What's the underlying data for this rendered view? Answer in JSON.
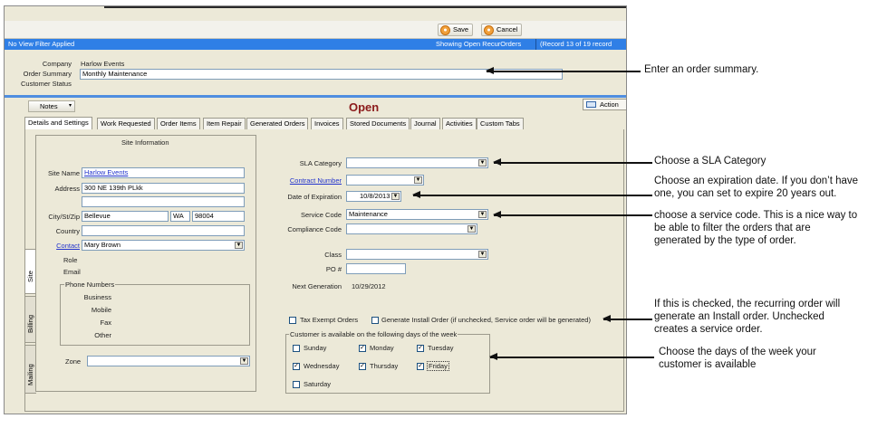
{
  "toolbar": {
    "save_label": "Save",
    "cancel_label": "Cancel"
  },
  "status_bar": {
    "filter_text": "No View Filter Applied",
    "showing_text": "Showing Open RecurOrders",
    "record_text": "(Record 13 of 19 record"
  },
  "header": {
    "company_label": "Company",
    "company_value": "Harlow Events",
    "order_summary_label": "Order Summary",
    "order_summary_value": "Monthly Maintenance",
    "customer_status_label": "Customer Status"
  },
  "notes_button": "Notes",
  "status_title": "Open",
  "action_button": "Action",
  "tabs": [
    "Details and Settings",
    "Work Requested",
    "Order Items",
    "Item Repair",
    "Generated Orders",
    "Invoices",
    "Stored Documents",
    "Journal",
    "Activities",
    "Custom Tabs"
  ],
  "side_tabs": [
    "Site",
    "Billing",
    "Mailing"
  ],
  "site": {
    "section_title": "Site Information",
    "site_name_label": "Site Name",
    "site_name_value": "Harlow Events",
    "address_label": "Address",
    "address_value": "300 NE 139th PLkk",
    "city_label": "City/St/Zip",
    "city_value": "Bellevue",
    "state_value": "WA",
    "zip_value": "98004",
    "country_label": "Country",
    "contact_label": "Contact",
    "contact_value": "Mary Brown",
    "role_label": "Role",
    "email_label": "Email",
    "phone_group_label": "Phone Numbers",
    "business_label": "Business",
    "mobile_label": "Mobile",
    "fax_label": "Fax",
    "other_label": "Other",
    "zone_label": "Zone"
  },
  "settings": {
    "sla_label": "SLA Category",
    "contract_label": "Contract Number",
    "expiration_label": "Date of Expiration",
    "expiration_value": "10/8/2013",
    "service_code_label": "Service Code",
    "service_code_value": "Maintenance",
    "compliance_label": "Compliance Code",
    "class_label": "Class",
    "po_label": "PO #",
    "next_gen_label": "Next Generation",
    "next_gen_value": "10/29/2012",
    "tax_exempt_label": "Tax Exempt Orders",
    "tax_exempt_checked": false,
    "install_label": "Generate Install Order (if unchecked, Service order will be generated)",
    "install_checked": false,
    "days_group_label": "Customer is available on the following days of the week",
    "days": [
      {
        "label": "Sunday",
        "checked": false
      },
      {
        "label": "Monday",
        "checked": true
      },
      {
        "label": "Tuesday",
        "checked": true
      },
      {
        "label": "Wednesday",
        "checked": true
      },
      {
        "label": "Thursday",
        "checked": true
      },
      {
        "label": "Friday",
        "checked": true
      },
      {
        "label": "Saturday",
        "checked": false
      }
    ]
  },
  "annotations": {
    "summary": "Enter an order summary.",
    "sla": "Choose a SLA Category",
    "expiration_1": "Choose an expiration date. If you don’t have",
    "expiration_2": "one, you can set to expire 20 years out.",
    "service_1": "choose a service code. This is a nice way to",
    "service_2": "be able to filter the orders that are",
    "service_3": "generated by the type of order.",
    "install_1": "If this is checked, the recurring order will",
    "install_2": "generate an Install order. Unchecked",
    "install_3": "creates a service order.",
    "days_1": "Choose the days of the week your",
    "days_2": "customer is available"
  },
  "colors": {
    "status_bar": "#2f7fe6",
    "open_status": "#8b1a1a",
    "link": "#2233cc",
    "window_bg": "#ece9d8"
  }
}
